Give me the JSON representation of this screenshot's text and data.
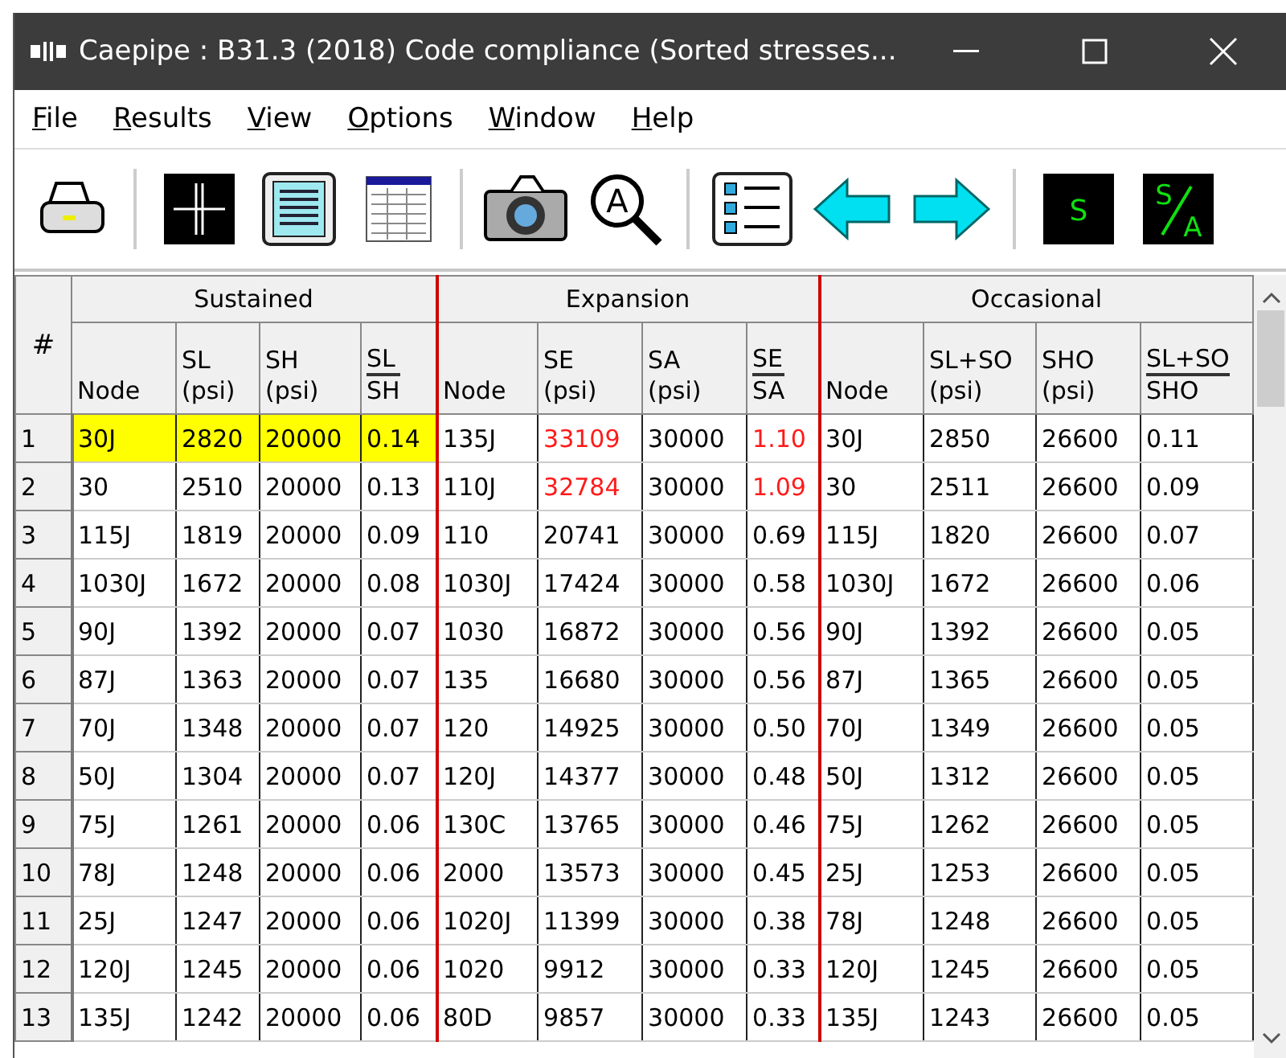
{
  "window": {
    "title": "Caepipe : B31.3 (2018) Code compliance (Sorted stresses..."
  },
  "menu": [
    "File",
    "Results",
    "View",
    "Options",
    "Window",
    "Help"
  ],
  "toolbar": [
    {
      "kind": "printer"
    },
    {
      "kind": "separator"
    },
    {
      "kind": "crosshair"
    },
    {
      "kind": "document"
    },
    {
      "kind": "table"
    },
    {
      "kind": "separator"
    },
    {
      "kind": "camera"
    },
    {
      "kind": "zoom",
      "label": "A"
    },
    {
      "kind": "separator"
    },
    {
      "kind": "list"
    },
    {
      "kind": "arrow-left"
    },
    {
      "kind": "arrow-right"
    },
    {
      "kind": "separator"
    },
    {
      "kind": "letter",
      "label": "S"
    },
    {
      "kind": "fraction",
      "label": "S",
      "sublabel": "A"
    }
  ],
  "table": {
    "index_header": "#",
    "groups": [
      {
        "title": "Sustained",
        "columns": [
          {
            "kind": "plain",
            "text": "Node"
          },
          {
            "kind": "unit",
            "text": "SL",
            "unit": "(psi)"
          },
          {
            "kind": "unit",
            "text": "SH",
            "unit": "(psi)"
          },
          {
            "kind": "ratio",
            "text": "SL",
            "unit": "SH"
          }
        ]
      },
      {
        "title": "Expansion",
        "columns": [
          {
            "kind": "plain",
            "text": "Node"
          },
          {
            "kind": "unit",
            "text": "SE",
            "unit": "(psi)"
          },
          {
            "kind": "unit",
            "text": "SA",
            "unit": "(psi)"
          },
          {
            "kind": "ratio",
            "text": "SE",
            "unit": "SA"
          }
        ]
      },
      {
        "title": "Occasional",
        "columns": [
          {
            "kind": "plain",
            "text": "Node"
          },
          {
            "kind": "unit",
            "text": "SL+SO",
            "unit": "(psi)"
          },
          {
            "kind": "unit",
            "text": "SHO",
            "unit": "(psi)"
          },
          {
            "kind": "ratio",
            "text": "SL+SO",
            "unit": "SHO"
          }
        ]
      }
    ],
    "rows": [
      {
        "index": "1",
        "highlighted": true,
        "exceeds": true,
        "cells": [
          "30J",
          "2820",
          "20000",
          "0.14",
          "135J",
          "33109",
          "30000",
          "1.10",
          "30J",
          "2850",
          "26600",
          "0.11"
        ]
      },
      {
        "index": "2",
        "highlighted": false,
        "exceeds": true,
        "cells": [
          "30",
          "2510",
          "20000",
          "0.13",
          "110J",
          "32784",
          "30000",
          "1.09",
          "30",
          "2511",
          "26600",
          "0.09"
        ]
      },
      {
        "index": "3",
        "highlighted": false,
        "exceeds": false,
        "cells": [
          "115J",
          "1819",
          "20000",
          "0.09",
          "110",
          "20741",
          "30000",
          "0.69",
          "115J",
          "1820",
          "26600",
          "0.07"
        ]
      },
      {
        "index": "4",
        "highlighted": false,
        "exceeds": false,
        "cells": [
          "1030J",
          "1672",
          "20000",
          "0.08",
          "1030J",
          "17424",
          "30000",
          "0.58",
          "1030J",
          "1672",
          "26600",
          "0.06"
        ]
      },
      {
        "index": "5",
        "highlighted": false,
        "exceeds": false,
        "cells": [
          "90J",
          "1392",
          "20000",
          "0.07",
          "1030",
          "16872",
          "30000",
          "0.56",
          "90J",
          "1392",
          "26600",
          "0.05"
        ]
      },
      {
        "index": "6",
        "highlighted": false,
        "exceeds": false,
        "cells": [
          "87J",
          "1363",
          "20000",
          "0.07",
          "135",
          "16680",
          "30000",
          "0.56",
          "87J",
          "1365",
          "26600",
          "0.05"
        ]
      },
      {
        "index": "7",
        "highlighted": false,
        "exceeds": false,
        "cells": [
          "70J",
          "1348",
          "20000",
          "0.07",
          "120",
          "14925",
          "30000",
          "0.50",
          "70J",
          "1349",
          "26600",
          "0.05"
        ]
      },
      {
        "index": "8",
        "highlighted": false,
        "exceeds": false,
        "cells": [
          "50J",
          "1304",
          "20000",
          "0.07",
          "120J",
          "14377",
          "30000",
          "0.48",
          "50J",
          "1312",
          "26600",
          "0.05"
        ]
      },
      {
        "index": "9",
        "highlighted": false,
        "exceeds": false,
        "cells": [
          "75J",
          "1261",
          "20000",
          "0.06",
          "130C",
          "13765",
          "30000",
          "0.46",
          "75J",
          "1262",
          "26600",
          "0.05"
        ]
      },
      {
        "index": "10",
        "highlighted": false,
        "exceeds": false,
        "cells": [
          "78J",
          "1248",
          "20000",
          "0.06",
          "2000",
          "13573",
          "30000",
          "0.45",
          "25J",
          "1253",
          "26600",
          "0.05"
        ]
      },
      {
        "index": "11",
        "highlighted": false,
        "exceeds": false,
        "cells": [
          "25J",
          "1247",
          "20000",
          "0.06",
          "1020J",
          "11399",
          "30000",
          "0.38",
          "78J",
          "1248",
          "26600",
          "0.05"
        ]
      },
      {
        "index": "12",
        "highlighted": false,
        "exceeds": false,
        "cells": [
          "120J",
          "1245",
          "20000",
          "0.06",
          "1020",
          "9912",
          "30000",
          "0.33",
          "120J",
          "1245",
          "26600",
          "0.05"
        ]
      },
      {
        "index": "13",
        "highlighted": false,
        "exceeds": false,
        "cells": [
          "135J",
          "1242",
          "20000",
          "0.06",
          "80D",
          "9857",
          "30000",
          "0.33",
          "135J",
          "1243",
          "26600",
          "0.05"
        ]
      }
    ]
  }
}
